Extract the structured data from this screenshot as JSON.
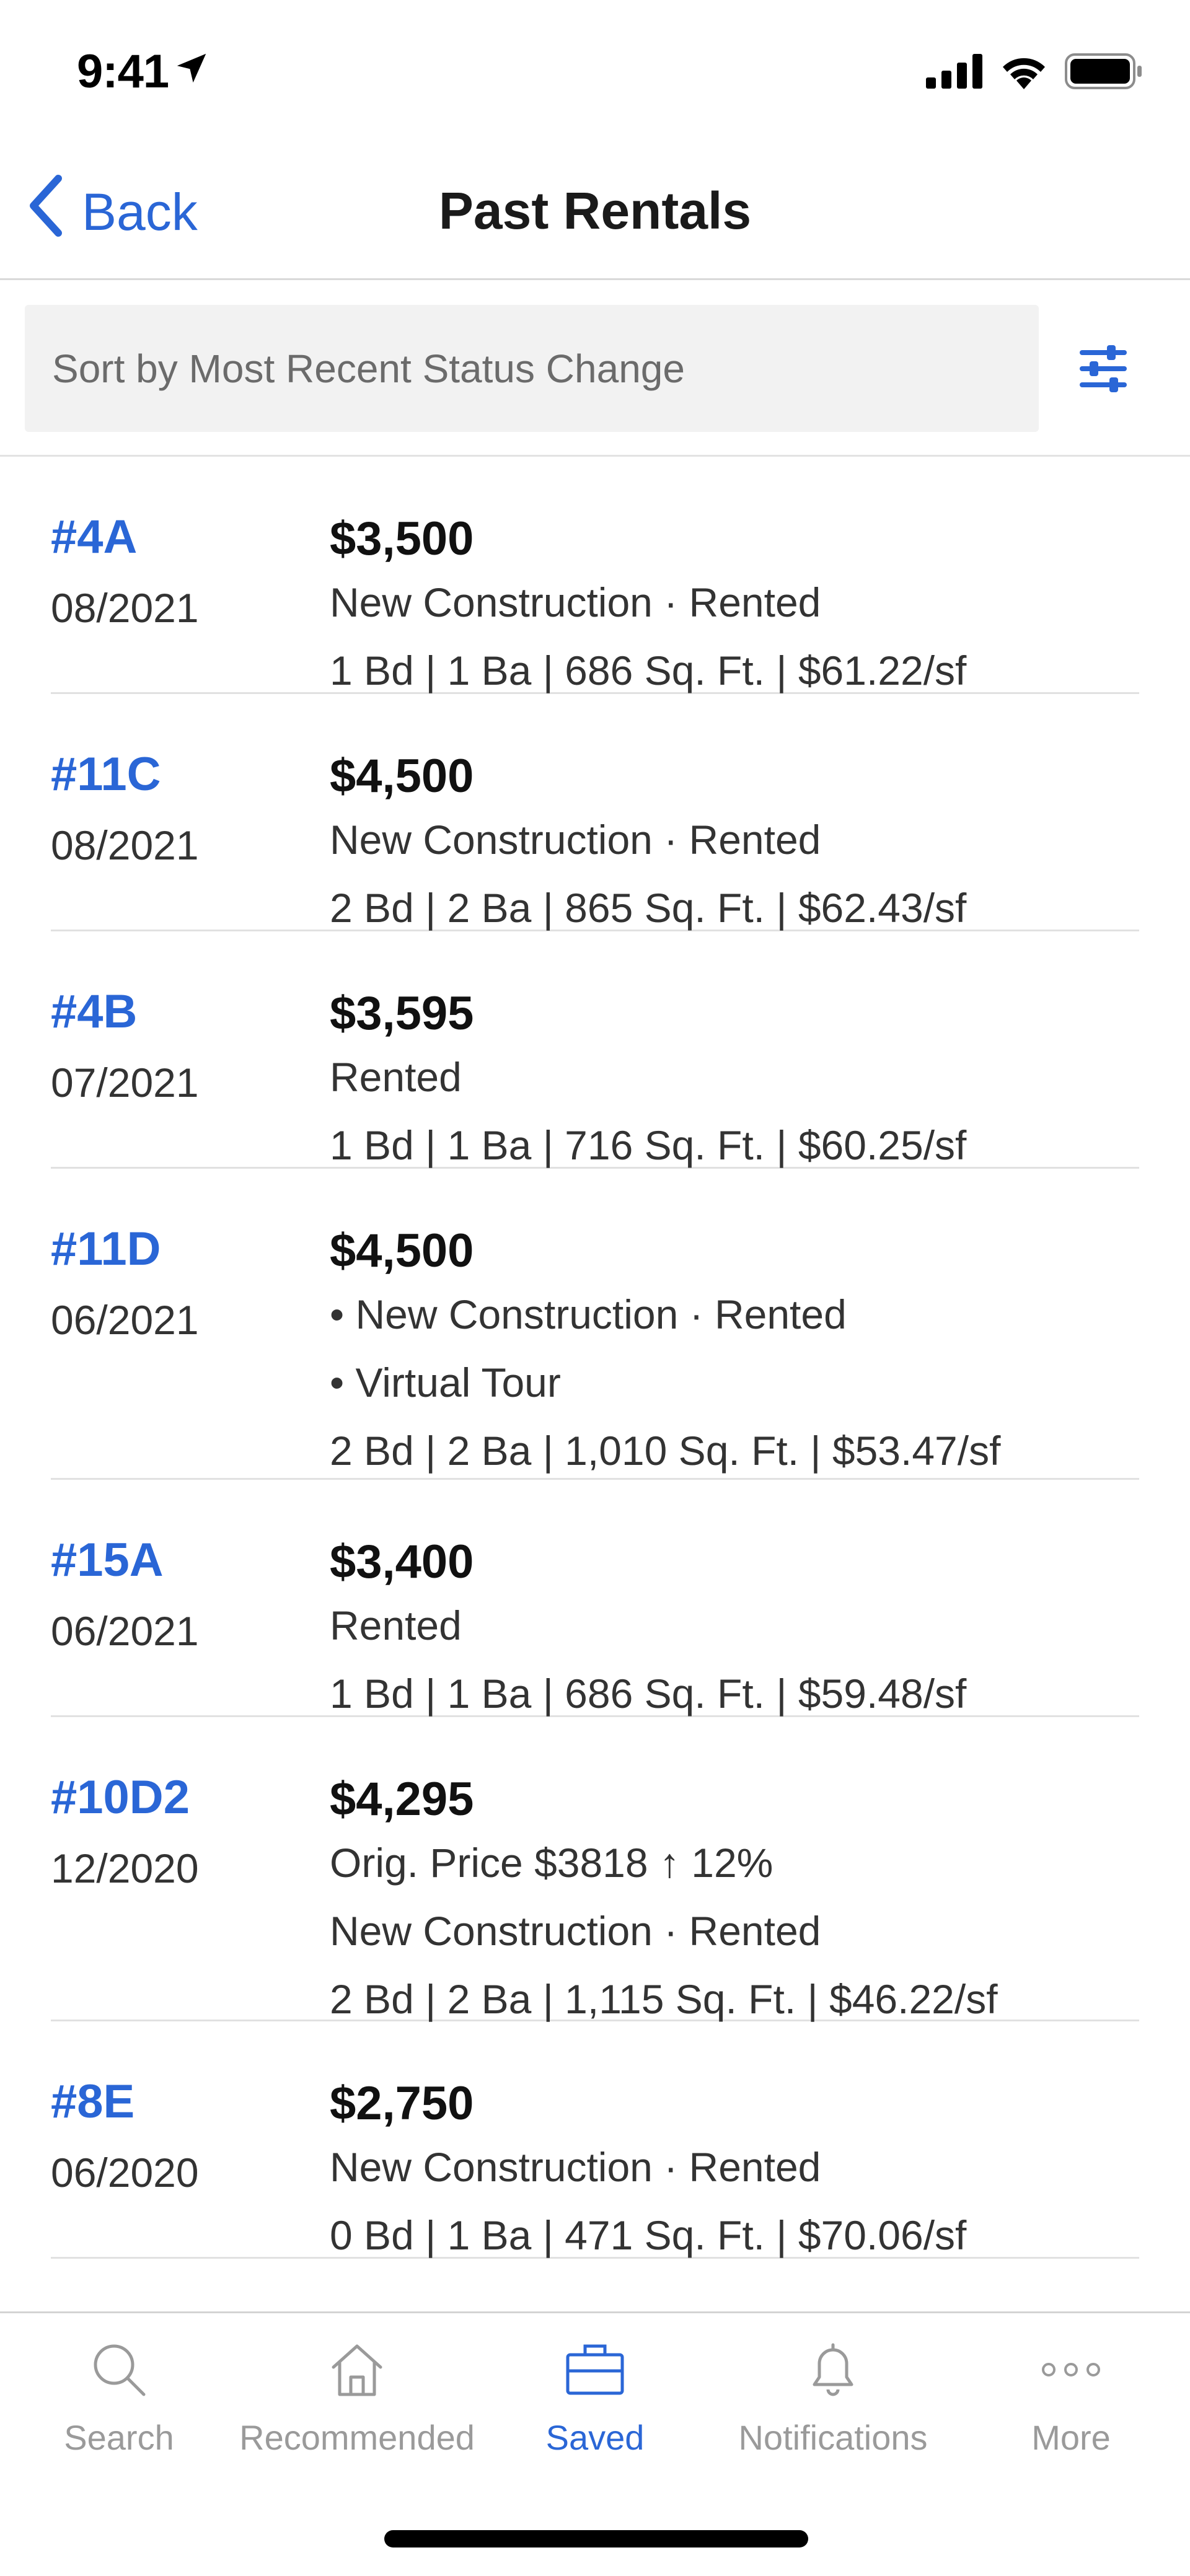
{
  "status_bar": {
    "time": "9:41"
  },
  "header": {
    "back_label": "Back",
    "title": "Past Rentals"
  },
  "sort": {
    "label": "Sort by Most Recent Status Change"
  },
  "listings": [
    {
      "unit": "#4A",
      "date": "08/2021",
      "price": "$3,500",
      "lines": [
        "New Construction · Rented",
        "1 Bd | 1 Ba | 686 Sq. Ft. | $61.22/sf"
      ]
    },
    {
      "unit": "#11C",
      "date": "08/2021",
      "price": "$4,500",
      "lines": [
        "New Construction · Rented",
        "2 Bd | 2 Ba | 865 Sq. Ft. | $62.43/sf"
      ]
    },
    {
      "unit": "#4B",
      "date": "07/2021",
      "price": "$3,595",
      "lines": [
        "Rented",
        "1 Bd | 1 Ba | 716 Sq. Ft. | $60.25/sf"
      ]
    },
    {
      "unit": "#11D",
      "date": "06/2021",
      "price": "$4,500",
      "lines": [
        "• New Construction · Rented",
        "• Virtual Tour",
        "2 Bd | 2 Ba | 1,010 Sq. Ft. | $53.47/sf"
      ]
    },
    {
      "unit": "#15A",
      "date": "06/2021",
      "price": "$3,400",
      "lines": [
        "Rented",
        "1 Bd | 1 Ba | 686 Sq. Ft. | $59.48/sf"
      ]
    },
    {
      "unit": "#10D2",
      "date": "12/2020",
      "price": "$4,295",
      "lines": [
        "Orig. Price $3818 ↑ 12%",
        "New Construction · Rented",
        "2 Bd | 2 Ba | 1,115 Sq. Ft. | $46.22/sf"
      ]
    },
    {
      "unit": "#8E",
      "date": "06/2020",
      "price": "$2,750",
      "lines": [
        "New Construction · Rented",
        "0 Bd | 1 Ba | 471 Sq. Ft. | $70.06/sf"
      ]
    }
  ],
  "tabs": [
    {
      "label": "Search",
      "icon": "search-icon",
      "active": false
    },
    {
      "label": "Recommended",
      "icon": "home-icon",
      "active": false
    },
    {
      "label": "Saved",
      "icon": "briefcase-icon",
      "active": true
    },
    {
      "label": "Notifications",
      "icon": "bell-icon",
      "active": false
    },
    {
      "label": "More",
      "icon": "more-icon",
      "active": false
    }
  ],
  "colors": {
    "accent": "#2a66d6",
    "inactive": "#9a9a9a",
    "divider": "#e1e1e1"
  }
}
